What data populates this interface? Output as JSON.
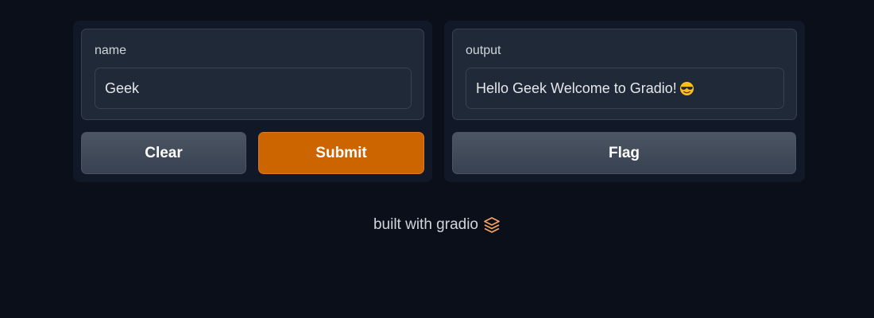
{
  "input_panel": {
    "label": "name",
    "value": "Geek",
    "clear_label": "Clear",
    "submit_label": "Submit"
  },
  "output_panel": {
    "label": "output",
    "value": "Hello Geek Welcome to Gradio!",
    "emoji": "smiling-face-with-sunglasses-icon",
    "flag_label": "Flag"
  },
  "footer": {
    "text": "built with gradio",
    "logo": "gradio-logo-icon"
  },
  "colors": {
    "background": "#0b0f19",
    "panel": "#111827",
    "block": "#1f2937",
    "primary": "#cc6400",
    "secondary": "#4b5563"
  }
}
